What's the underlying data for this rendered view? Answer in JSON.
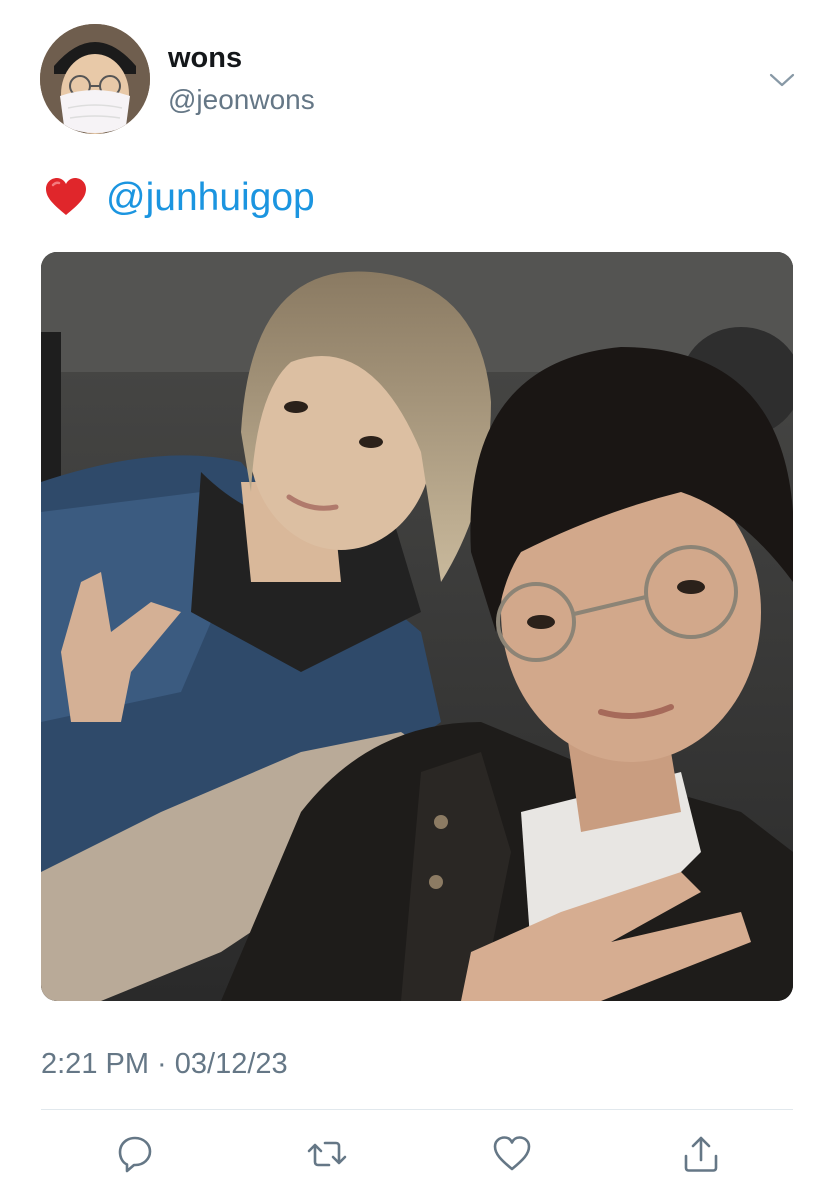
{
  "tweet": {
    "author": {
      "display_name": "wons",
      "handle": "@jeonwons",
      "avatar_icon": "profile-photo-masked"
    },
    "menu_icon": "chevron-down-icon",
    "text": {
      "emoji": "❤️",
      "mention": "@junhuigop"
    },
    "media": {
      "type": "photo",
      "description_icon": "car-selfie-photo"
    },
    "timestamp": "2:21 PM · 03/12/23",
    "actions": [
      {
        "name": "reply",
        "icon": "reply-icon"
      },
      {
        "name": "retweet",
        "icon": "retweet-icon"
      },
      {
        "name": "like",
        "icon": "heart-icon"
      },
      {
        "name": "share",
        "icon": "share-icon"
      }
    ]
  },
  "colors": {
    "text_primary": "#14171a",
    "text_secondary": "#657786",
    "link": "#1b95e0",
    "divider": "#e1e8ed",
    "icon": "#657786",
    "heart_emoji": "#e0262b"
  }
}
